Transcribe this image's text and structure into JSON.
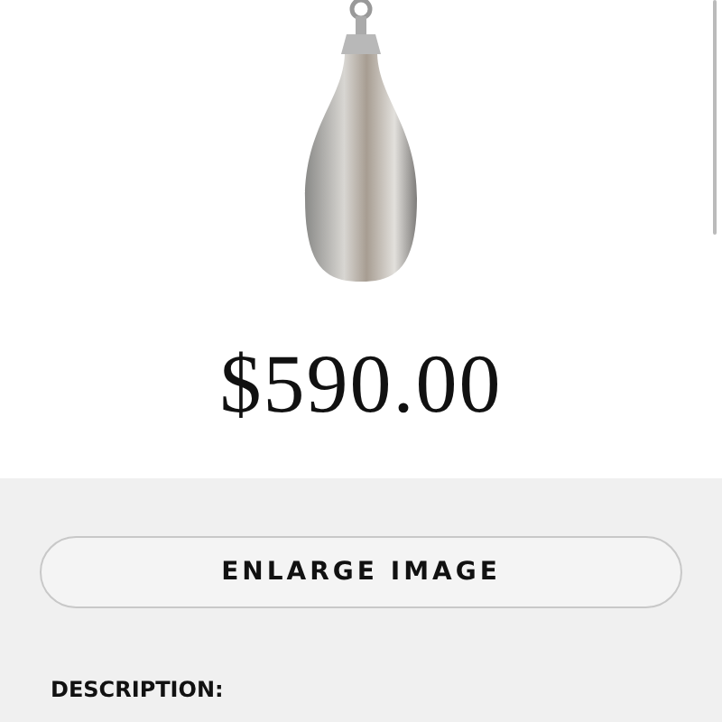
{
  "product": {
    "price": "$590.00"
  },
  "enlarge_button": {
    "label": "ENLARGE IMAGE"
  },
  "description": {
    "heading": "DESCRIPTION:"
  }
}
